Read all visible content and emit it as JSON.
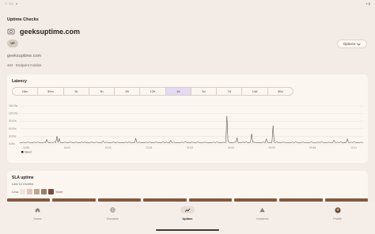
{
  "status_bar": {
    "left": "7:52 ●",
    "right": "▾ ▮"
  },
  "page": {
    "title": "Uptime Checks",
    "site_name": "geeksuptime.com",
    "status_badge": "UP",
    "options_label": "Options",
    "url": "geeksuptime.com",
    "description": "444 · Endpoint monitor"
  },
  "latency": {
    "title": "Latency",
    "ranges": [
      "15m",
      "30m",
      "1h",
      "3h",
      "6h",
      "12h",
      "1d",
      "3d",
      "7d",
      "14d",
      "30d"
    ],
    "active_range": "1d",
    "legend_label": "Meant"
  },
  "chart_data": {
    "type": "line",
    "ylabel": "",
    "y_ticks": [
      "150.00s",
      "120.00s",
      "90.00s",
      "60.00s",
      "30.00s",
      "0.00s"
    ],
    "ylim": [
      0,
      150
    ],
    "x_ticks": [
      "12:56",
      "16:00",
      "19:02",
      "22:18",
      "01:03",
      "04:03",
      "06:39",
      "09:48",
      "12:11"
    ],
    "series": [
      {
        "name": "Meant",
        "values": [
          5,
          6,
          4,
          7,
          5,
          6,
          5,
          8,
          5,
          6,
          4,
          6,
          5,
          7,
          6,
          5,
          9,
          5,
          6,
          4,
          5,
          6,
          7,
          5,
          18,
          6,
          5,
          4,
          7,
          5,
          6,
          8,
          5,
          30,
          6,
          22,
          5,
          6,
          4,
          5,
          7,
          6,
          5,
          6,
          5,
          8,
          6,
          5,
          4,
          6,
          7,
          5,
          6,
          5,
          4,
          9,
          5,
          6,
          7,
          5,
          6,
          4,
          5,
          6,
          7,
          5,
          6,
          5,
          8,
          6,
          5,
          4,
          6,
          5,
          12,
          6,
          5,
          7,
          6,
          5,
          4,
          6,
          5,
          8,
          6,
          5,
          6,
          7,
          5,
          6,
          5,
          4,
          6,
          5,
          7,
          6,
          5,
          8,
          6,
          5,
          6,
          4,
          5,
          22,
          6,
          5,
          7,
          6,
          5,
          4,
          6,
          5,
          7,
          6,
          5,
          8,
          6,
          5,
          4,
          6,
          5,
          7,
          6,
          5,
          6,
          4,
          5,
          8,
          6,
          5,
          7,
          6,
          5,
          4,
          14,
          5,
          6,
          7,
          5,
          6,
          5,
          4,
          6,
          5,
          7,
          6,
          5,
          8,
          6,
          5,
          6,
          4,
          5,
          7,
          6,
          5,
          6,
          5,
          8,
          6,
          5,
          4,
          6,
          5,
          7,
          6,
          5,
          6,
          5,
          4,
          6,
          5,
          7,
          6,
          5,
          9,
          6,
          5,
          4,
          6,
          5,
          7,
          6,
          5,
          110,
          8,
          6,
          5,
          4,
          6,
          5,
          7,
          6,
          24,
          5,
          4,
          6,
          5,
          7,
          6,
          5,
          8,
          6,
          5,
          4,
          6,
          40,
          5,
          7,
          6,
          5,
          6,
          5,
          4,
          6,
          5,
          7,
          6,
          5,
          20,
          6,
          5,
          4,
          6,
          5,
          72,
          6,
          5,
          8,
          6,
          5,
          4,
          6,
          5,
          7,
          6,
          5,
          6,
          5,
          4,
          6,
          5,
          7,
          6,
          5,
          8,
          6,
          5,
          4,
          6,
          5,
          7,
          6,
          5,
          6,
          5,
          4,
          6,
          5,
          9,
          6,
          5,
          4,
          6,
          5,
          7,
          6,
          5,
          8,
          6,
          5,
          4,
          6,
          5,
          7,
          6,
          5,
          6,
          5,
          15,
          6,
          5,
          7,
          6,
          5,
          8,
          6,
          5,
          4,
          6,
          5,
          20,
          6,
          5,
          7,
          6,
          5,
          8,
          6,
          5,
          4,
          6,
          5,
          7,
          6,
          5
        ]
      }
    ]
  },
  "sla": {
    "title": "SLA uptime",
    "subtitle": "Last 12 months",
    "less_label": "Less",
    "more_label": "More",
    "legend_colors": [
      "#ece4de",
      "#d8c8bd",
      "#c0a595",
      "#a07a66",
      "#7a4e3a"
    ],
    "bar_count": 8,
    "bar_color": "#84583f"
  },
  "nav": {
    "items": [
      {
        "label": "Home",
        "icon": "home-icon"
      },
      {
        "label": "Domains",
        "icon": "globe-icon"
      },
      {
        "label": "Uptime",
        "icon": "trend-icon"
      },
      {
        "label": "Incidents",
        "icon": "warning-icon"
      },
      {
        "label": "Profile",
        "icon": "avatar"
      }
    ],
    "active": "Uptime"
  },
  "colors": {
    "accent": "#e4daf3",
    "line": "#2a2220",
    "background": "#f3ebe5",
    "card": "#fcf6f1"
  }
}
